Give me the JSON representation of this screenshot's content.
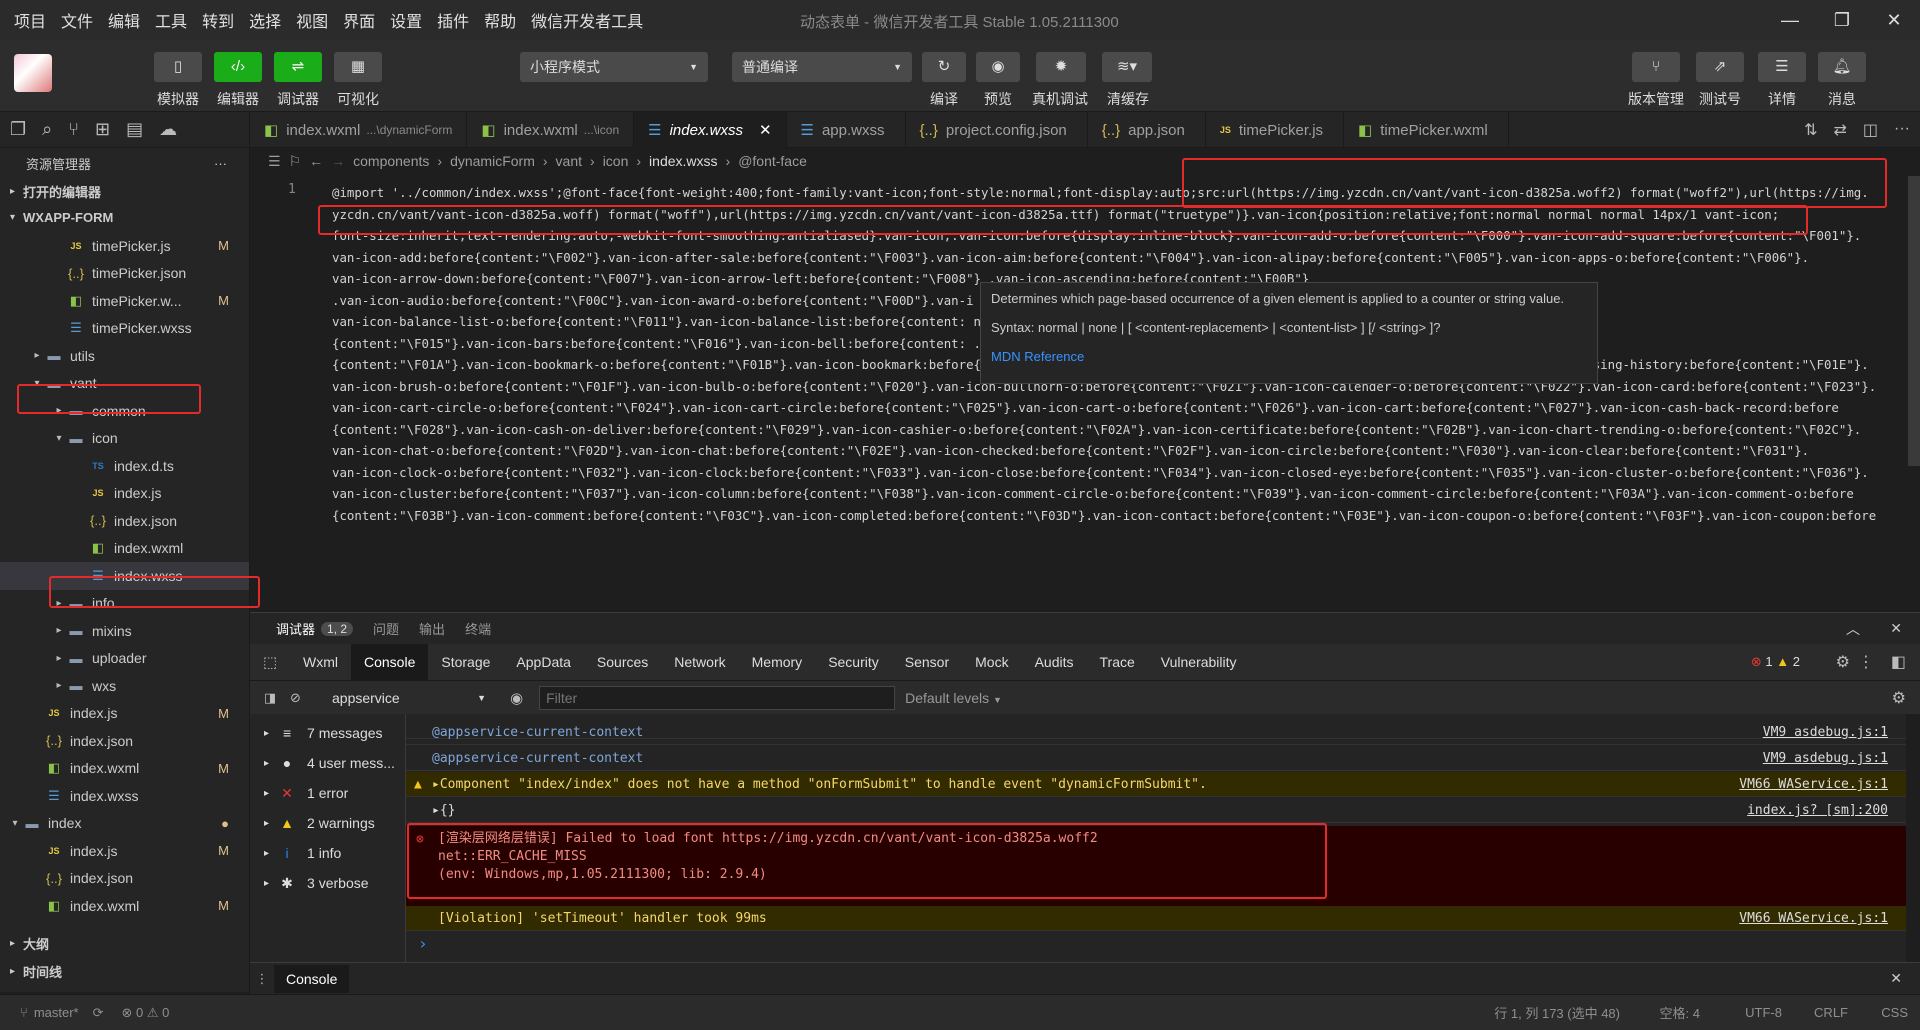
{
  "menubar": [
    "项目",
    "文件",
    "编辑",
    "工具",
    "转到",
    "选择",
    "视图",
    "界面",
    "设置",
    "插件",
    "帮助",
    "微信开发者工具"
  ],
  "window_title": "动态表单 - 微信开发者工具 Stable 1.05.2111300",
  "toolbar": {
    "simulator": "模拟器",
    "editor": "编辑器",
    "debugger": "调试器",
    "visual": "可视化",
    "mode_select": "小程序模式",
    "compile_select": "普通编译",
    "compile": "编译",
    "preview": "预览",
    "device_debug": "真机调试",
    "clear_cache": "清缓存",
    "version": "版本管理",
    "test": "测试号",
    "details": "详情",
    "messages": "消息"
  },
  "sidebar": {
    "header": "资源管理器",
    "open_editors": "打开的编辑器",
    "project": "WXAPP-FORM",
    "outline": "大纲",
    "timeline": "时间线",
    "tree": [
      {
        "label": "timePicker.js",
        "type": "js",
        "indent": 3,
        "mod": "M"
      },
      {
        "label": "timePicker.json",
        "type": "json",
        "indent": 3,
        "mod": ""
      },
      {
        "label": "timePicker.w...",
        "type": "wxml",
        "indent": 3,
        "mod": "M"
      },
      {
        "label": "timePicker.wxss",
        "type": "wxss",
        "indent": 3,
        "mod": ""
      },
      {
        "label": "utils",
        "type": "folder",
        "indent": 2,
        "arrow": "▸",
        "mod": ""
      },
      {
        "label": "vant",
        "type": "folder",
        "indent": 2,
        "arrow": "▾",
        "mod": ""
      },
      {
        "label": "common",
        "type": "folder",
        "indent": 3,
        "arrow": "▸",
        "mod": ""
      },
      {
        "label": "icon",
        "type": "folder",
        "indent": 3,
        "arrow": "▾",
        "mod": ""
      },
      {
        "label": "index.d.ts",
        "type": "ts",
        "indent": 4,
        "mod": ""
      },
      {
        "label": "index.js",
        "type": "js",
        "indent": 4,
        "mod": ""
      },
      {
        "label": "index.json",
        "type": "json",
        "indent": 4,
        "mod": ""
      },
      {
        "label": "index.wxml",
        "type": "wxml",
        "indent": 4,
        "mod": ""
      },
      {
        "label": "index.wxss",
        "type": "wxss",
        "indent": 4,
        "mod": "",
        "selected": true
      },
      {
        "label": "info",
        "type": "folder",
        "indent": 3,
        "arrow": "▸",
        "mod": ""
      },
      {
        "label": "mixins",
        "type": "folder",
        "indent": 3,
        "arrow": "▸",
        "mod": ""
      },
      {
        "label": "uploader",
        "type": "folder",
        "indent": 3,
        "arrow": "▸",
        "mod": ""
      },
      {
        "label": "wxs",
        "type": "folder",
        "indent": 3,
        "arrow": "▸",
        "mod": ""
      },
      {
        "label": "index.js",
        "type": "js",
        "indent": 2,
        "mod": "M"
      },
      {
        "label": "index.json",
        "type": "json",
        "indent": 2,
        "mod": ""
      },
      {
        "label": "index.wxml",
        "type": "wxml",
        "indent": 2,
        "mod": "M"
      },
      {
        "label": "index.wxss",
        "type": "wxss",
        "indent": 2,
        "mod": ""
      },
      {
        "label": "index",
        "type": "folder",
        "indent": 1,
        "arrow": "▾",
        "mod": "●"
      },
      {
        "label": "index.js",
        "type": "js",
        "indent": 2,
        "mod": "M"
      },
      {
        "label": "index.json",
        "type": "json",
        "indent": 2,
        "mod": ""
      },
      {
        "label": "index.wxml",
        "type": "wxml",
        "indent": 2,
        "mod": "M"
      }
    ]
  },
  "tabs": [
    {
      "label": "index.wxml",
      "sub": "...\\dynamicForm",
      "type": "wxml"
    },
    {
      "label": "index.wxml",
      "sub": "...\\icon",
      "type": "wxml"
    },
    {
      "label": "index.wxss",
      "sub": "",
      "type": "wxss",
      "active": true
    },
    {
      "label": "app.wxss",
      "sub": "",
      "type": "wxss"
    },
    {
      "label": "project.config.json",
      "sub": "",
      "type": "json"
    },
    {
      "label": "app.json",
      "sub": "",
      "type": "json"
    },
    {
      "label": "timePicker.js",
      "sub": "",
      "type": "js"
    },
    {
      "label": "timePicker.wxml",
      "sub": "",
      "type": "wxml"
    }
  ],
  "breadcrumb": [
    "components",
    "dynamicForm",
    "vant",
    "icon",
    "index.wxss",
    "@font-face"
  ],
  "code": {
    "line_number": "1",
    "lines": [
      "@import '../common/index.wxss';@font-face{font-weight:400;font-family:vant-icon;font-style:normal;font-display:auto;src:url(https://img.yzcdn.cn/vant/vant-icon-d3825a.woff2) format(\"woff2\"),url(https://img.",
      "yzcdn.cn/vant/vant-icon-d3825a.woff) format(\"woff\"),url(https://img.yzcdn.cn/vant/vant-icon-d3825a.ttf) format(\"truetype\")}.van-icon{position:relative;font:normal normal normal 14px/1 vant-icon;",
      "font-size:inherit;text-rendering:auto;-webkit-font-smoothing:antialiased}.van-icon,.van-icon:before{display:inline-block}.van-icon-add-o:before{content:\"\\F000\"}.van-icon-add-square:before{content:\"\\F001\"}.",
      "van-icon-add:before{content:\"\\F002\"}.van-icon-after-sale:before{content:\"\\F003\"}.van-icon-aim:before{content:\"\\F004\"}.van-icon-alipay:before{content:\"\\F005\"}.van-icon-apps-o:before{content:\"\\F006\"}.",
      "van-icon-arrow-down:before{content:\"\\F007\"}.van-icon-arrow-left:before{content:\"\\F008\"}                                                      .van-icon-ascending:before{content:\"\\F00B\"}",
      ".van-icon-audio:before{content:\"\\F00C\"}.van-icon-award-o:before{content:\"\\F00D\"}.van-i                                                       :before{content:\"\\F010\"}.",
      "van-icon-balance-list-o:before{content:\"\\F011\"}.van-icon-balance-list:before{content:                                                      nt:\"\\F014\"}.van-icon-bar-chart-o:before",
      "{content:\"\\F015\"}.van-icon-bars:before{content:\"\\F016\"}.van-icon-bell:before{content:                                                       .van-icon-birthday-cake-o:before",
      "{content:\"\\F01A\"}.van-icon-bookmark-o:before{content:\"\\F01B\"}.van-icon-bookmark:before{content:\"\\F01C\"}.van-icon-browsing-history-o:before{content:\"\\F01D\"}.van-icon-browsing-history:before{content:\"\\F01E\"}.",
      "van-icon-brush-o:before{content:\"\\F01F\"}.van-icon-bulb-o:before{content:\"\\F020\"}.van-icon-bullhorn-o:before{content:\"\\F021\"}.van-icon-calender-o:before{content:\"\\F022\"}.van-icon-card:before{content:\"\\F023\"}.",
      "van-icon-cart-circle-o:before{content:\"\\F024\"}.van-icon-cart-circle:before{content:\"\\F025\"}.van-icon-cart-o:before{content:\"\\F026\"}.van-icon-cart:before{content:\"\\F027\"}.van-icon-cash-back-record:before",
      "{content:\"\\F028\"}.van-icon-cash-on-deliver:before{content:\"\\F029\"}.van-icon-cashier-o:before{content:\"\\F02A\"}.van-icon-certificate:before{content:\"\\F02B\"}.van-icon-chart-trending-o:before{content:\"\\F02C\"}.",
      "van-icon-chat-o:before{content:\"\\F02D\"}.van-icon-chat:before{content:\"\\F02E\"}.van-icon-checked:before{content:\"\\F02F\"}.van-icon-circle:before{content:\"\\F030\"}.van-icon-clear:before{content:\"\\F031\"}.",
      "van-icon-clock-o:before{content:\"\\F032\"}.van-icon-clock:before{content:\"\\F033\"}.van-icon-close:before{content:\"\\F034\"}.van-icon-closed-eye:before{content:\"\\F035\"}.van-icon-cluster-o:before{content:\"\\F036\"}.",
      "van-icon-cluster:before{content:\"\\F037\"}.van-icon-column:before{content:\"\\F038\"}.van-icon-comment-circle-o:before{content:\"\\F039\"}.van-icon-comment-circle:before{content:\"\\F03A\"}.van-icon-comment-o:before",
      "{content:\"\\F03B\"}.van-icon-comment:before{content:\"\\F03C\"}.van-icon-completed:before{content:\"\\F03D\"}.van-icon-contact:before{content:\"\\F03E\"}.van-icon-coupon-o:before{content:\"\\F03F\"}.van-icon-coupon:before"
    ]
  },
  "tooltip": {
    "description": "Determines which page-based occurrence of a given element is applied to a counter or string value.",
    "syntax": "Syntax: normal | none | [ <content-replacement> | <content-list> ] [/ <string> ]?",
    "link": "MDN Reference"
  },
  "panel": {
    "tab_debugger": "调试器",
    "badge": "1, 2",
    "tab_problems": "问题",
    "tab_output": "输出",
    "tab_terminal": "终端"
  },
  "devtools_tabs": [
    "Wxml",
    "Console",
    "Storage",
    "AppData",
    "Sources",
    "Network",
    "Memory",
    "Security",
    "Sensor",
    "Mock",
    "Audits",
    "Trace",
    "Vulnerability"
  ],
  "devtools_counts": {
    "errors": "1",
    "warnings": "2"
  },
  "console": {
    "context": "appservice",
    "filter_placeholder": "Filter",
    "levels": "Default levels",
    "sidebar": [
      {
        "icon": "≡",
        "label": "7 messages"
      },
      {
        "icon": "●",
        "label": "4 user mess..."
      },
      {
        "icon": "✕",
        "label": "1 error",
        "color": "#e53935"
      },
      {
        "icon": "▲",
        "label": "2 warnings",
        "color": "#f5c518"
      },
      {
        "icon": "i",
        "label": "1 info",
        "color": "#1e88e5"
      },
      {
        "icon": "✱",
        "label": "3 verbose"
      }
    ],
    "messages": [
      {
        "text": "@appservice-current-context",
        "src": "VM9 asdebug.js:1",
        "kind": "log"
      },
      {
        "text": "@appservice-current-context",
        "src": "VM9 asdebug.js:1",
        "kind": "log"
      },
      {
        "text": "▸Component \"index/index\" does not have a method \"onFormSubmit\" to handle event \"dynamicFormSubmit\".",
        "src": "VM66 WAService.js:1",
        "kind": "warn"
      },
      {
        "text": "▸{}",
        "src": "index.js? [sm]:200",
        "kind": "log"
      }
    ],
    "error_lines": [
      "[渲染层网络层错误] Failed to load font https://img.yzcdn.cn/vant/vant-icon-d3825a.woff2",
      "net::ERR_CACHE_MISS",
      "(env: Windows,mp,1.05.2111300; lib: 2.9.4)"
    ],
    "violation": {
      "text": "[Violation] 'setTimeout' handler took 99ms",
      "src": "VM66 WAService.js:1"
    },
    "prompt": "›",
    "footer_tab": "Console"
  },
  "statusbar": {
    "branch": "master*",
    "problems": "⊗ 0 ⚠ 0",
    "position": "行 1, 列 173 (选中 48)",
    "spaces": "空格: 4",
    "encoding": "UTF-8",
    "eol": "CRLF",
    "language": "CSS"
  }
}
